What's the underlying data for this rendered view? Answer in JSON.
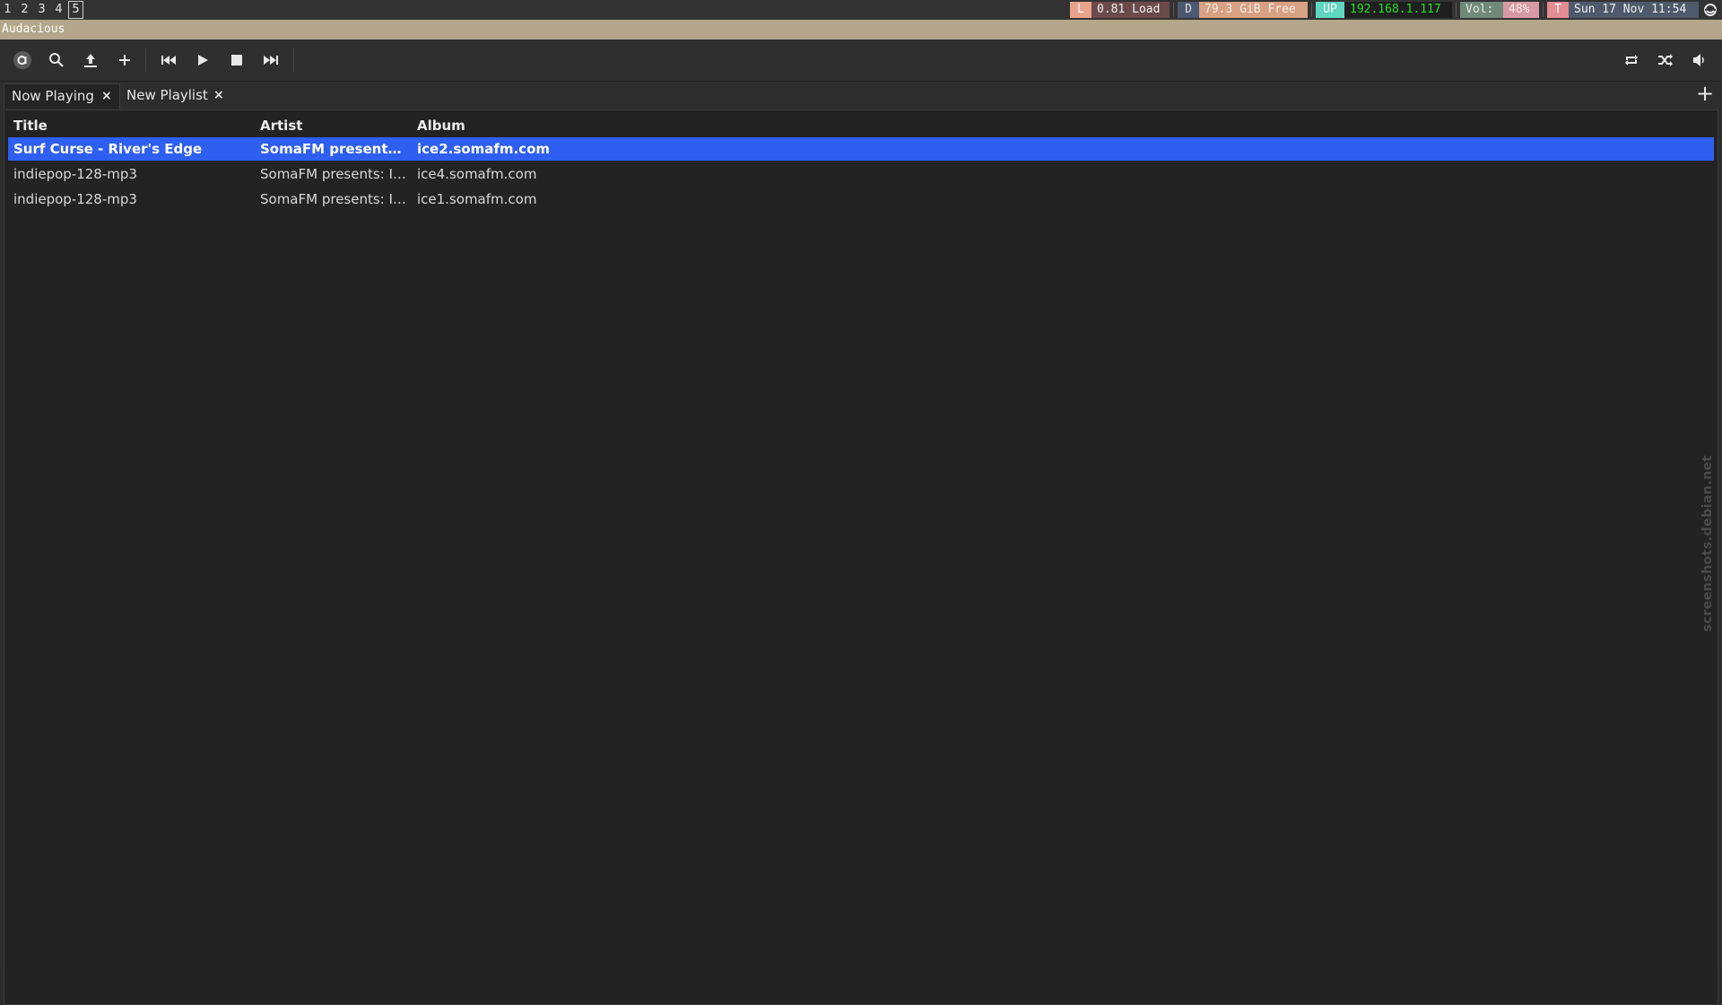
{
  "status_bar": {
    "workspaces": [
      "1",
      "2",
      "3",
      "4",
      "5"
    ],
    "active_workspace": "5",
    "load": {
      "tag": "L",
      "value": "0.81 Load"
    },
    "disk": {
      "tag": "D",
      "value": "79.3 GiB Free"
    },
    "network": {
      "tag": "UP",
      "value": "192.168.1.117"
    },
    "volume": {
      "tag": "Vol:",
      "value": "48%"
    },
    "time": {
      "tag": "T",
      "value": "Sun 17 Nov 11:54"
    }
  },
  "window": {
    "title": "Audacious"
  },
  "toolbar": {
    "buttons": [
      "app-menu",
      "search",
      "open",
      "add",
      "previous",
      "play",
      "stop",
      "next"
    ],
    "right_buttons": [
      "repeat",
      "shuffle",
      "volume"
    ]
  },
  "tabs": [
    {
      "label": "Now Playing",
      "close": "×"
    },
    {
      "label": "New Playlist",
      "close": "×"
    }
  ],
  "add_tab": "+",
  "playlist": {
    "columns": [
      "Title",
      "Artist",
      "Album"
    ],
    "rows": [
      {
        "title": "Surf Curse - River's Edge",
        "artist": "SomaFM present…",
        "album": "ice2.somafm.com",
        "selected": true
      },
      {
        "title": "indiepop-128-mp3",
        "artist": "SomaFM presents: I…",
        "album": "ice4.somafm.com",
        "selected": false
      },
      {
        "title": "indiepop-128-mp3",
        "artist": "SomaFM presents: I…",
        "album": "ice1.somafm.com",
        "selected": false
      }
    ]
  },
  "watermark": "screenshots.debian.net",
  "colors": {
    "selection": "#2f5ff0",
    "title_strip": "#b4a68a",
    "network_ip": "#22e022"
  }
}
